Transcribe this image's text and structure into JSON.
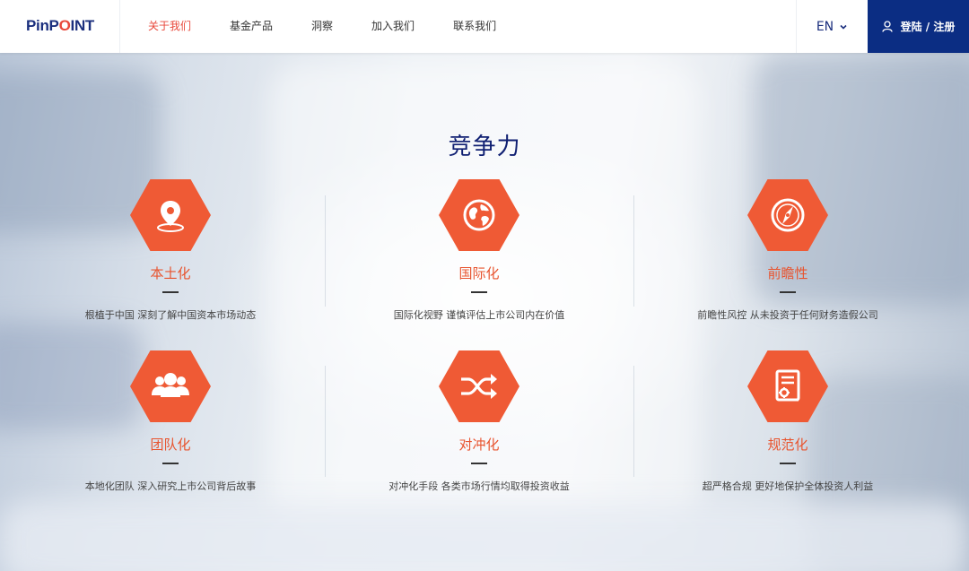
{
  "header": {
    "logo_prefix": "PinP",
    "logo_o": "O",
    "logo_suffix": "INT",
    "nav": [
      "关于我们",
      "基金产品",
      "洞察",
      "加入我们",
      "联系我们"
    ],
    "active_nav": "关于我们",
    "lang": "EN",
    "login": "登陆 / 注册"
  },
  "section": {
    "title": "竞争力",
    "items": [
      {
        "icon": "location-pin-icon",
        "title": "本土化",
        "desc": "根植于中国 深刻了解中国资本市场动态"
      },
      {
        "icon": "globe-icon",
        "title": "国际化",
        "desc": "国际化视野 谨慎评估上市公司内在价值"
      },
      {
        "icon": "compass-icon",
        "title": "前瞻性",
        "desc": "前瞻性风控 从未投资于任何财务造假公司"
      },
      {
        "icon": "team-icon",
        "title": "团队化",
        "desc": "本地化团队 深入研究上市公司背后故事"
      },
      {
        "icon": "shuffle-icon",
        "title": "对冲化",
        "desc": "对冲化手段 各类市场行情均取得投资收益"
      },
      {
        "icon": "compliance-document-icon",
        "title": "规范化",
        "desc": "超严格合规 更好地保护全体投资人利益"
      }
    ]
  },
  "colors": {
    "brand_blue": "#0b2d83",
    "accent_orange": "#ef5a35",
    "active_red": "#e8483b"
  }
}
